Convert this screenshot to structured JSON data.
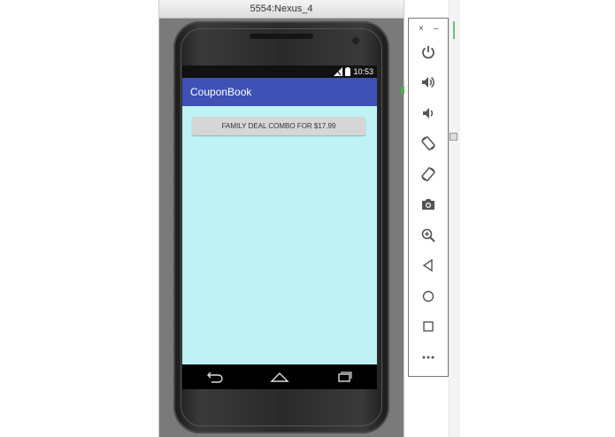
{
  "emulator": {
    "window_title": "5554:Nexus_4"
  },
  "status_bar": {
    "time": "10:53"
  },
  "app": {
    "title": "CouponBook",
    "deal_button_label": "FAMILY DEAL COMBO FOR $17.99",
    "background_color": "#bff2f3",
    "appbar_color": "#3f51b5"
  },
  "navigation": {
    "icons": [
      "back-icon",
      "home-icon",
      "recents-icon"
    ]
  },
  "toolbar": {
    "close_label": "×",
    "minimize_label": "–",
    "tools": [
      "power-icon",
      "volume-up-icon",
      "volume-down-icon",
      "rotate-left-icon",
      "rotate-right-icon",
      "camera-icon",
      "zoom-icon",
      "back-icon",
      "home-icon",
      "overview-icon",
      "more-icon"
    ]
  }
}
